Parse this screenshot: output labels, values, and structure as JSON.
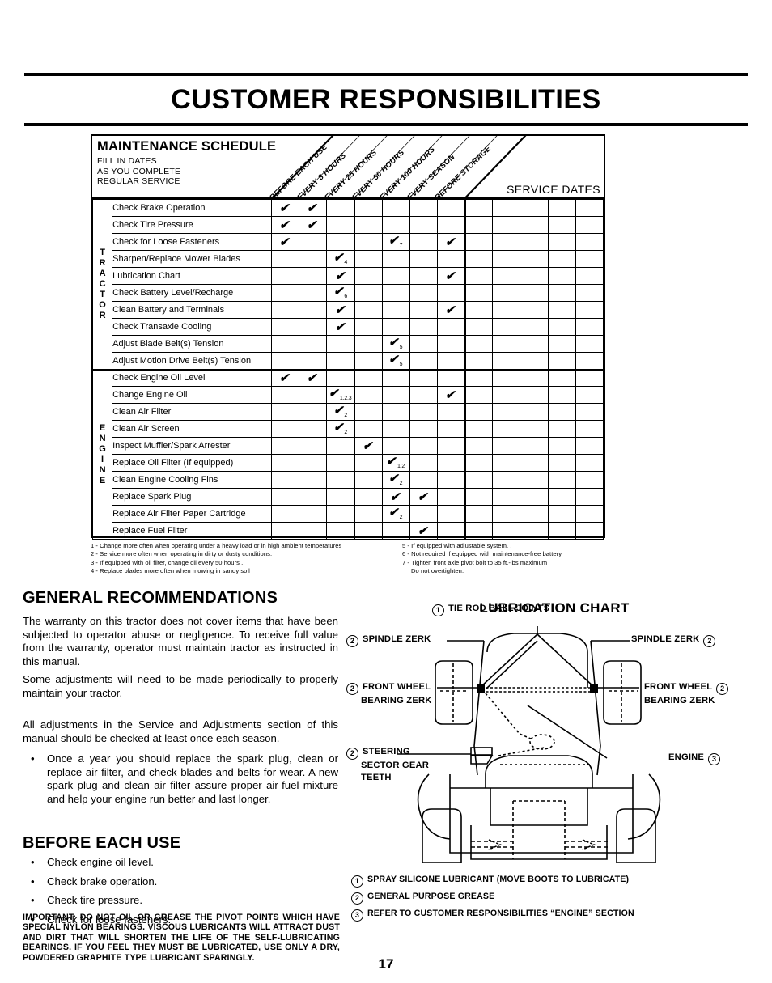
{
  "page": {
    "title": "CUSTOMER RESPONSIBILITIES",
    "number": "17"
  },
  "maintenance_table": {
    "heading": "MAINTENANCE SCHEDULE",
    "subheading_lines": [
      "FILL IN DATES",
      "AS YOU COMPLETE",
      "REGULAR SERVICE"
    ],
    "service_dates_label": "SERVICE DATES",
    "interval_columns": [
      "BEFORE EACH USE",
      "EVERY 8 HOURS",
      "EVERY 25 HOURS",
      "EVERY 50 HOURS",
      "EVERY 100 HOURS",
      "EVERY SEASON",
      "BEFORE STORAGE"
    ],
    "service_date_column_count": 5,
    "check_glyph": "✔",
    "sections": [
      {
        "group_label": "TRACTOR",
        "rows": [
          {
            "task": "Check Brake Operation",
            "marks": [
              {
                "col": 0
              },
              {
                "col": 1
              }
            ]
          },
          {
            "task": "Check Tire Pressure",
            "marks": [
              {
                "col": 0
              },
              {
                "col": 1
              }
            ]
          },
          {
            "task": "Check for Loose Fasteners",
            "marks": [
              {
                "col": 0
              },
              {
                "col": 4,
                "note": "7"
              },
              {
                "col": 6
              }
            ]
          },
          {
            "task": "Sharpen/Replace Mower Blades",
            "marks": [
              {
                "col": 2,
                "note": "4"
              }
            ]
          },
          {
            "task": "Lubrication Chart",
            "marks": [
              {
                "col": 2
              },
              {
                "col": 6
              }
            ]
          },
          {
            "task": "Check Battery Level/Recharge",
            "marks": [
              {
                "col": 2,
                "note": "6"
              }
            ]
          },
          {
            "task": "Clean Battery and Terminals",
            "marks": [
              {
                "col": 2
              },
              {
                "col": 6
              }
            ]
          },
          {
            "task": "Check Transaxle Cooling",
            "marks": [
              {
                "col": 2
              }
            ]
          },
          {
            "task": "Adjust Blade Belt(s) Tension",
            "marks": [
              {
                "col": 4,
                "note": "5"
              }
            ]
          },
          {
            "task": "Adjust Motion Drive Belt(s) Tension",
            "marks": [
              {
                "col": 4,
                "note": "5"
              }
            ]
          }
        ]
      },
      {
        "group_label": "ENGINE",
        "rows": [
          {
            "task": "Check Engine Oil Level",
            "marks": [
              {
                "col": 0
              },
              {
                "col": 1
              }
            ]
          },
          {
            "task": "Change Engine Oil",
            "marks": [
              {
                "col": 2,
                "note": "1,2,3"
              },
              {
                "col": 6
              }
            ]
          },
          {
            "task": "Clean Air Filter",
            "marks": [
              {
                "col": 2,
                "note": "2"
              }
            ]
          },
          {
            "task": "Clean Air Screen",
            "marks": [
              {
                "col": 2,
                "note": "2"
              }
            ]
          },
          {
            "task": "Inspect Muffler/Spark Arrester",
            "marks": [
              {
                "col": 3
              }
            ]
          },
          {
            "task": "Replace Oil Filter (If equipped)",
            "marks": [
              {
                "col": 4,
                "note": "1,2"
              }
            ]
          },
          {
            "task": "Clean Engine Cooling Fins",
            "marks": [
              {
                "col": 4,
                "note": "2"
              }
            ]
          },
          {
            "task": "Replace Spark Plug",
            "marks": [
              {
                "col": 4
              },
              {
                "col": 5
              }
            ]
          },
          {
            "task": "Replace Air Filter Paper Cartridge",
            "marks": [
              {
                "col": 4,
                "note": "2"
              }
            ]
          },
          {
            "task": "Replace Fuel Filter",
            "marks": [
              {
                "col": 5
              }
            ]
          }
        ]
      }
    ],
    "footnotes_left": [
      "1 - Change more often when operating under a heavy load or in high ambient temperatures",
      "2 - Service more often when operating in dirty or dusty conditions.",
      "3 - If equipped with oil filter, change oil every 50 hours .",
      "4 - Replace blades more often when mowing in sandy soil"
    ],
    "footnotes_right": [
      "5 - If equipped with adjustable system. .",
      "6 - Not required if equipped with maintenance-free battery",
      "7 - Tighten front axle pivot bolt to 35 ft.-lbs  maximum"
    ],
    "footnote_right_cont": "Do not overtighten."
  },
  "general_recommendations": {
    "heading": "GENERAL RECOMMENDATIONS",
    "para1": "The warranty on this tractor does not cover items that have been subjected to operator abuse or negligence.  To receive full value from the warranty, operator must maintain tractor as instructed in this manual.",
    "para2": "Some adjustments will need to be made periodically to properly maintain your tractor.",
    "para3": "All adjustments in the Service and Adjustments section of this manual should be checked at least once each season.",
    "bullet": "Once a year you should replace the spark plug, clean or replace air filter, and check blades and belts for wear.  A new spark plug and clean air filter assure proper air-fuel mixture and help your engine run better and last longer.",
    "bullet_glyph": "•"
  },
  "before_each_use": {
    "heading": "BEFORE EACH USE",
    "items": [
      "Check engine oil level.",
      "Check brake operation.",
      "Check tire pressure.",
      "Check for loose fasteners."
    ]
  },
  "important_note": "IMPORTANT:  DO NOT OIL OR GREASE THE PIVOT POINTS WHICH HAVE SPECIAL NYLON BEARINGS.  VISCOUS LUBRICANTS WILL ATTRACT DUST AND DIRT THAT WILL SHORTEN THE LIFE OF THE SELF-LUBRICATING BEARINGS.  IF YOU FEEL THEY MUST BE LUBRICATED, USE ONLY A DRY, POWDERED GRAPHITE TYPE LUBRICANT SPARINGLY.",
  "lubrication_chart": {
    "heading": "LUBRICATION CHART",
    "callouts": {
      "tie_rod": {
        "num": "1",
        "text": "TIE ROD BALL JOINTS"
      },
      "spindle_left": {
        "num": "2",
        "text": "SPINDLE ZERK"
      },
      "spindle_right": {
        "num": "2",
        "text": "SPINDLE ZERK"
      },
      "front_wheel_left_l1": "FRONT WHEEL",
      "front_wheel_left_l2": "BEARING ZERK",
      "front_wheel_left_num": "2",
      "front_wheel_right_l1": "FRONT WHEEL",
      "front_wheel_right_l2": "BEARING ZERK",
      "front_wheel_right_num": "2",
      "steering_l1": "STEERING",
      "steering_l2": "SECTOR GEAR",
      "steering_l3": "TEETH",
      "steering_num": "2",
      "engine_text": "ENGINE",
      "engine_num": "3"
    },
    "legend": [
      {
        "num": "1",
        "text": "SPRAY SILICONE LUBRICANT (MOVE BOOTS TO LUBRICATE)"
      },
      {
        "num": "2",
        "text": "GENERAL PURPOSE GREASE"
      },
      {
        "num": "3",
        "text": "REFER TO CUSTOMER RESPONSIBILITIES “ENGINE” SECTION"
      }
    ]
  }
}
